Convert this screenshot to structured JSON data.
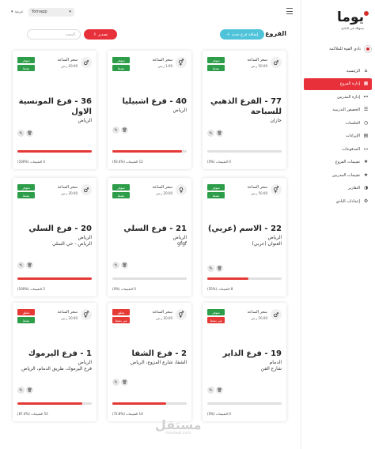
{
  "topbar": {
    "language": "عربية",
    "app_select": "Yomapp"
  },
  "sidebar": {
    "logo_text": "يوما",
    "logo_subtitle": "يسهلك في النادي",
    "club_name": "نادي القوة للملاكمة",
    "items": [
      {
        "label": "الرئيسية",
        "icon": "home-icon",
        "glyph": "⌂",
        "active": false
      },
      {
        "label": "إدارة الفروع",
        "icon": "branch-icon",
        "glyph": "▦",
        "active": true
      },
      {
        "label": "إدارة المدربين",
        "icon": "dumbbell-icon",
        "glyph": "⊶",
        "active": false
      },
      {
        "label": "الحصص التدريبية",
        "icon": "users-icon",
        "glyph": "☰",
        "active": false
      },
      {
        "label": "الجلسات",
        "icon": "clock-icon",
        "glyph": "◷",
        "active": false
      },
      {
        "label": "الإيرادات",
        "icon": "receipt-icon",
        "glyph": "▤",
        "active": false
      },
      {
        "label": "المدفوعات",
        "icon": "payment-icon",
        "glyph": "▭",
        "active": false
      },
      {
        "label": "تقييمات الفروع",
        "icon": "star-icon",
        "glyph": "★",
        "active": false
      },
      {
        "label": "تقييمات المدربين",
        "icon": "star-icon",
        "glyph": "★",
        "active": false
      },
      {
        "label": "التقارير",
        "icon": "report-icon",
        "glyph": "◑",
        "active": false
      },
      {
        "label": "إعدادات النادي",
        "icon": "settings-icon",
        "glyph": "⚙",
        "active": false
      }
    ]
  },
  "header": {
    "title": "الفروع",
    "add_branch_label": "إضافة فرع جديد",
    "export_label": "تصدير",
    "search_placeholder": "البحث"
  },
  "cards": [
    {
      "title": "77 - الفرع الذهبي للسباحة",
      "city": "جازان",
      "address": "",
      "price_label": "سعر الساعة",
      "price": "50.00 ر.س",
      "gender": "male",
      "badges": [
        {
          "text": "متوفر",
          "color": "green"
        },
        {
          "text": "نشط",
          "color": "green"
        }
      ],
      "rating_text": "0 التقييمات (%0)",
      "rating_pct": 0
    },
    {
      "title": "40 - فرع اشبيليا",
      "city": "الرياض",
      "address": "",
      "price_label": "سعر الساعة",
      "price": "1.00 ر.س",
      "gender": "mixed",
      "badges": [
        {
          "text": "متوفر",
          "color": "green"
        },
        {
          "text": "نشط",
          "color": "green"
        }
      ],
      "rating_text": "12 التقييمات (%93.4)",
      "rating_pct": 93.4
    },
    {
      "title": "36 - فرع المونسية الاول",
      "city": "الرياض",
      "address": "",
      "price_label": "سعر الساعة",
      "price": "20.00 ر.س",
      "gender": "male",
      "badges": [
        {
          "text": "متوفر",
          "color": "green"
        },
        {
          "text": "نشط",
          "color": "green"
        }
      ],
      "rating_text": "4 التقييمات (%100)",
      "rating_pct": 100
    },
    {
      "title": "22 - الاسم (عربي)",
      "city": "الرياض",
      "address": "العنوان (عربي)",
      "price_label": "سعر الساعة",
      "price": "50.00 ر.س",
      "gender": "mixed",
      "badges": [
        {
          "text": "متوفر",
          "color": "green"
        },
        {
          "text": "نشط",
          "color": "green"
        }
      ],
      "rating_text": "8 التقييمات (%55)",
      "rating_pct": 55
    },
    {
      "title": "21 - فرع السلي",
      "city": "الرياض",
      "address": "gfgf",
      "price_label": "سعر الساعة",
      "price": "20.00 ر.س",
      "gender": "female",
      "badges": [
        {
          "text": "متوفر",
          "color": "green"
        },
        {
          "text": "نشط",
          "color": "green"
        }
      ],
      "rating_text": "0 التقييمات (%0)",
      "rating_pct": 0
    },
    {
      "title": "20 - فرع السلي",
      "city": "الرياض",
      "address": "الرياض - حي السلي",
      "price_label": "سعر الساعة",
      "price": "20.00 ر.س",
      "gender": "male",
      "badges": [
        {
          "text": "متوفر",
          "color": "green"
        },
        {
          "text": "نشط",
          "color": "green"
        }
      ],
      "rating_text": "2 التقييمات (%100)",
      "rating_pct": 100
    },
    {
      "title": "19 - فرع الداير",
      "city": "الدمام",
      "address": "شارع الفن",
      "price_label": "سعر الساعة",
      "price": "50.00 ر.س",
      "gender": "male",
      "badges": [
        {
          "text": "متوفر",
          "color": "green"
        },
        {
          "text": "غير نشط",
          "color": "red"
        }
      ],
      "rating_text": "0 التقييمات (%0)",
      "rating_pct": 0
    },
    {
      "title": "2 - فرع الشفا",
      "city": "الشفا، شارع المزوع، الرياض",
      "address": "",
      "price_label": "سعر الساعة",
      "price": "20.00 ر.س",
      "gender": "mixed",
      "badges": [
        {
          "text": "مغلق",
          "color": "red"
        },
        {
          "text": "غير نشط",
          "color": "red"
        }
      ],
      "rating_text": "14 التقييمات (%72.8)",
      "rating_pct": 72.8
    },
    {
      "title": "1 - فرع اليرموك",
      "city": "الرياض",
      "address": "فرع اليرموك، طريق الدمام، الرياض",
      "price_label": "سعر الساعة",
      "price": "20.00 ر.س",
      "gender": "mixed",
      "badges": [
        {
          "text": "مغلق",
          "color": "red"
        },
        {
          "text": "نشط",
          "color": "green"
        }
      ],
      "rating_text": "55 التقييمات (%87.4)",
      "rating_pct": 87.4
    }
  ],
  "watermark": {
    "big": "مستقل",
    "small": "mostaql.com"
  },
  "colors": {
    "accent_red": "#e8303a",
    "accent_teal": "#4fc3d9",
    "green": "#2e9d4a"
  }
}
